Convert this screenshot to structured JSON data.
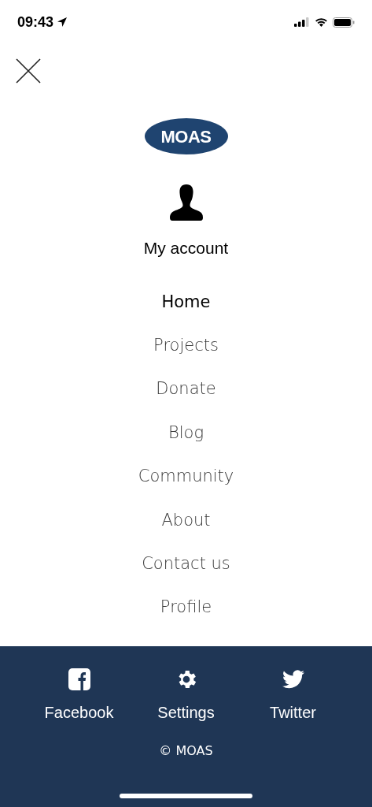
{
  "status_bar": {
    "time": "09:43"
  },
  "logo": {
    "text": "MOAS"
  },
  "account": {
    "label": "My account"
  },
  "menu": [
    {
      "label": "Home",
      "selected": true
    },
    {
      "label": "Projects",
      "selected": false
    },
    {
      "label": "Donate",
      "selected": false
    },
    {
      "label": "Blog",
      "selected": false
    },
    {
      "label": "Community",
      "selected": false
    },
    {
      "label": "About",
      "selected": false
    },
    {
      "label": "Contact us",
      "selected": false
    },
    {
      "label": "Profile",
      "selected": false
    }
  ],
  "footer": {
    "links": [
      {
        "kind": "facebook",
        "label": "Facebook"
      },
      {
        "kind": "settings",
        "label": "Settings"
      },
      {
        "kind": "twitter",
        "label": "Twitter"
      }
    ],
    "copyright": "© MOAS"
  }
}
